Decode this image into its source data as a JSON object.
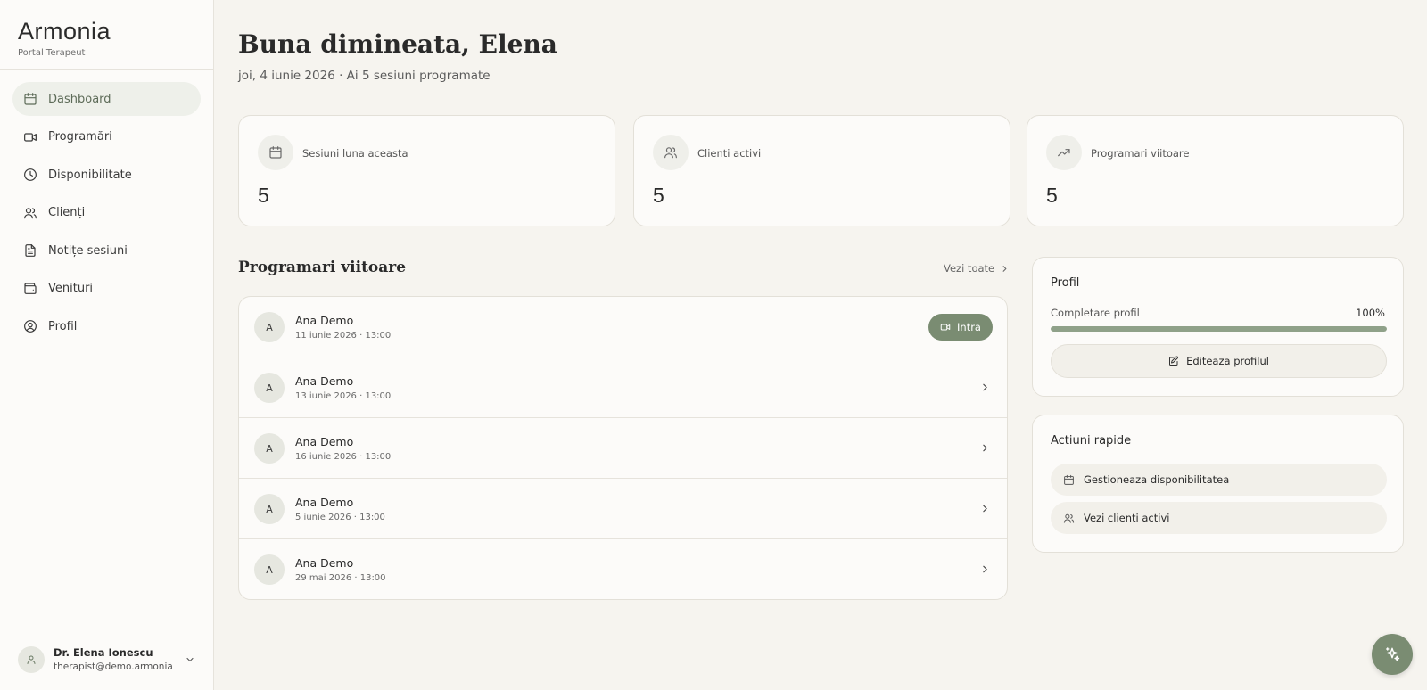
{
  "brand": {
    "name": "Armonia",
    "subtitle": "Portal Terapeut"
  },
  "nav": [
    {
      "label": "Dashboard",
      "icon": "calendar-icon",
      "active": true
    },
    {
      "label": "Programări",
      "icon": "video-icon"
    },
    {
      "label": "Disponibilitate",
      "icon": "clock-icon"
    },
    {
      "label": "Clienți",
      "icon": "users-icon"
    },
    {
      "label": "Notițe sesiuni",
      "icon": "file-text-icon"
    },
    {
      "label": "Venituri",
      "icon": "wallet-icon"
    },
    {
      "label": "Profil",
      "icon": "user-circle-icon"
    }
  ],
  "user": {
    "name": "Dr. Elena Ionescu",
    "email": "therapist@demo.armonia"
  },
  "header": {
    "greeting": "Buna dimineata, Elena",
    "subline": "joi, 4 iunie 2026 · Ai 5 sesiuni programate"
  },
  "stats": [
    {
      "label": "Sesiuni luna aceasta",
      "value": "5",
      "icon": "calendar-icon"
    },
    {
      "label": "Clienti activi",
      "value": "5",
      "icon": "users-icon"
    },
    {
      "label": "Programari viitoare",
      "value": "5",
      "icon": "trending-up-icon"
    }
  ],
  "appointments": {
    "title": "Programari viitoare",
    "see_all": "Vezi toate",
    "join_label": "Intra",
    "items": [
      {
        "initial": "A",
        "name": "Ana Demo",
        "date": "11 iunie 2026 · 13:00",
        "joinable": true
      },
      {
        "initial": "A",
        "name": "Ana Demo",
        "date": "13 iunie 2026 · 13:00"
      },
      {
        "initial": "A",
        "name": "Ana Demo",
        "date": "16 iunie 2026 · 13:00"
      },
      {
        "initial": "A",
        "name": "Ana Demo",
        "date": "5 iunie 2026 · 13:00"
      },
      {
        "initial": "A",
        "name": "Ana Demo",
        "date": "29 mai 2026 · 13:00"
      }
    ]
  },
  "profile": {
    "title": "Profil",
    "completion_label": "Completare profil",
    "completion_value": "100%",
    "completion_fraction": 1.0,
    "edit_label": "Editeaza profilul"
  },
  "quick_actions": {
    "title": "Actiuni rapide",
    "items": [
      {
        "label": "Gestioneaza disponibilitatea",
        "icon": "calendar-icon"
      },
      {
        "label": "Vezi clienti activi",
        "icon": "users-icon"
      }
    ]
  },
  "fab": {
    "icon": "sparkles-icon"
  },
  "colors": {
    "accent": "#7a8c72",
    "background": "#f6f4ef",
    "card": "#fcfbf9",
    "nav_active": "#eef0ea"
  }
}
